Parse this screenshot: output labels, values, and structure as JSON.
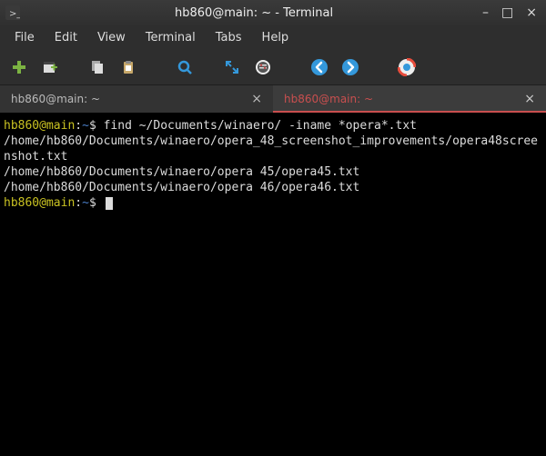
{
  "window": {
    "title": "hb860@main: ~ - Terminal"
  },
  "menus": {
    "items": [
      "File",
      "Edit",
      "View",
      "Terminal",
      "Tabs",
      "Help"
    ]
  },
  "toolbar": {
    "icons": [
      "new-tab-icon",
      "new-window-icon",
      "copy-icon",
      "paste-icon",
      "search-icon",
      "fullscreen-icon",
      "settings-icon",
      "back-icon",
      "forward-icon",
      "help-icon"
    ]
  },
  "tabs": {
    "items": [
      {
        "label": "hb860@main: ~",
        "active": false
      },
      {
        "label": "hb860@main: ~",
        "active": true
      }
    ]
  },
  "terminal": {
    "prompt_user_host": "hb860@main",
    "prompt_cwd": "~",
    "prompt_sep": ":",
    "prompt_end": "$",
    "command": "find ~/Documents/winaero/ -iname *opera*.txt",
    "output": [
      "/home/hb860/Documents/winaero/opera_48_screenshot_improvements/opera48screenshot.txt",
      "/home/hb860/Documents/winaero/opera 45/opera45.txt",
      "/home/hb860/Documents/winaero/opera 46/opera46.txt"
    ]
  }
}
